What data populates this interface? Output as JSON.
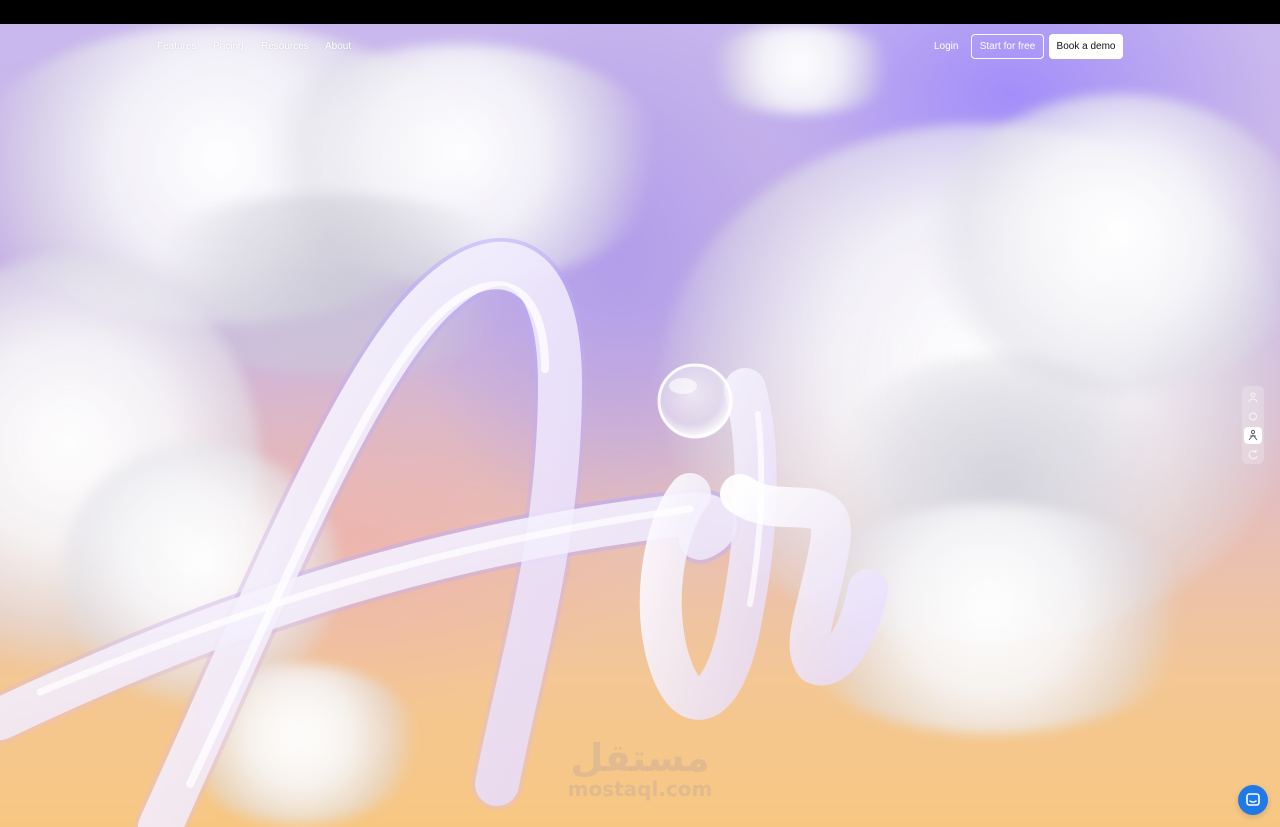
{
  "nav": {
    "links": [
      "Features",
      "Pricing",
      "Resources",
      "About"
    ],
    "login_label": "Login",
    "start_label": "Start for free",
    "demo_label": "Book a demo"
  },
  "hero": {
    "art_text": "Air",
    "colors": {
      "sky_top": "#c9b8ee",
      "sky_purple": "#a08cfa",
      "sky_bottom": "#f7c782",
      "cloud": "#f6f6f8",
      "tube_tint": "#b6a8ff"
    }
  },
  "side_switcher": {
    "items": [
      {
        "icon": "person-icon",
        "active": false
      },
      {
        "icon": "circle-icon",
        "active": false
      },
      {
        "icon": "figure-icon",
        "active": true
      },
      {
        "icon": "refresh-icon",
        "active": false
      }
    ]
  },
  "chat_widget": {
    "icon": "chat-bubble-icon",
    "color": "#1f7ae8"
  },
  "watermark": {
    "arabic": "مستقل",
    "latin": "mostaql.com"
  }
}
